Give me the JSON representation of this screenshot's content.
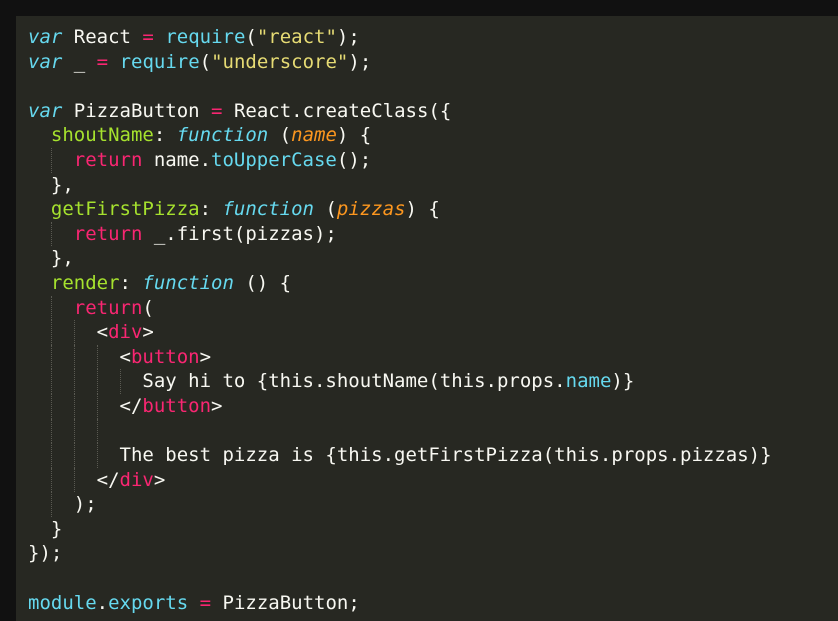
{
  "colors": {
    "background": "#272822",
    "frame": "#111111",
    "plain": "#F8F8F2",
    "storage": "#66D9EF",
    "keyword": "#F92672",
    "string": "#E6DB74",
    "function_name": "#A6E22E",
    "parameter": "#FD971F",
    "support": "#66D9EF"
  },
  "code": {
    "lines": [
      {
        "indent": 0,
        "tokens": [
          {
            "t": "var",
            "c": "storage",
            "i": true
          },
          {
            "t": " React ",
            "c": "plain"
          },
          {
            "t": "=",
            "c": "keyword"
          },
          {
            "t": " ",
            "c": "plain"
          },
          {
            "t": "require",
            "c": "support"
          },
          {
            "t": "(",
            "c": "plain"
          },
          {
            "t": "\"react\"",
            "c": "string"
          },
          {
            "t": ");",
            "c": "plain"
          }
        ]
      },
      {
        "indent": 0,
        "tokens": [
          {
            "t": "var",
            "c": "storage",
            "i": true
          },
          {
            "t": " _ ",
            "c": "plain"
          },
          {
            "t": "=",
            "c": "keyword"
          },
          {
            "t": " ",
            "c": "plain"
          },
          {
            "t": "require",
            "c": "support"
          },
          {
            "t": "(",
            "c": "plain"
          },
          {
            "t": "\"underscore\"",
            "c": "string"
          },
          {
            "t": ");",
            "c": "plain"
          }
        ]
      },
      {
        "indent": 0,
        "tokens": []
      },
      {
        "indent": 0,
        "tokens": [
          {
            "t": "var",
            "c": "storage",
            "i": true
          },
          {
            "t": " PizzaButton ",
            "c": "plain"
          },
          {
            "t": "=",
            "c": "keyword"
          },
          {
            "t": " React.createClass({",
            "c": "plain"
          }
        ]
      },
      {
        "indent": 1,
        "tokens": [
          {
            "t": "shoutName",
            "c": "function_name"
          },
          {
            "t": ": ",
            "c": "plain"
          },
          {
            "t": "function",
            "c": "storage",
            "i": true
          },
          {
            "t": " (",
            "c": "plain"
          },
          {
            "t": "name",
            "c": "parameter",
            "i": true
          },
          {
            "t": ") {",
            "c": "plain"
          }
        ]
      },
      {
        "indent": 2,
        "tokens": [
          {
            "t": "return",
            "c": "keyword"
          },
          {
            "t": " name.",
            "c": "plain"
          },
          {
            "t": "toUpperCase",
            "c": "support"
          },
          {
            "t": "();",
            "c": "plain"
          }
        ]
      },
      {
        "indent": 1,
        "tokens": [
          {
            "t": "},",
            "c": "plain"
          }
        ]
      },
      {
        "indent": 1,
        "tokens": [
          {
            "t": "getFirstPizza",
            "c": "function_name"
          },
          {
            "t": ": ",
            "c": "plain"
          },
          {
            "t": "function",
            "c": "storage",
            "i": true
          },
          {
            "t": " (",
            "c": "plain"
          },
          {
            "t": "pizzas",
            "c": "parameter",
            "i": true
          },
          {
            "t": ") {",
            "c": "plain"
          }
        ]
      },
      {
        "indent": 2,
        "tokens": [
          {
            "t": "return",
            "c": "keyword"
          },
          {
            "t": " _.first(pizzas);",
            "c": "plain"
          }
        ]
      },
      {
        "indent": 1,
        "tokens": [
          {
            "t": "},",
            "c": "plain"
          }
        ]
      },
      {
        "indent": 1,
        "tokens": [
          {
            "t": "render",
            "c": "function_name"
          },
          {
            "t": ": ",
            "c": "plain"
          },
          {
            "t": "function",
            "c": "storage",
            "i": true
          },
          {
            "t": " () {",
            "c": "plain"
          }
        ]
      },
      {
        "indent": 2,
        "tokens": [
          {
            "t": "return",
            "c": "keyword"
          },
          {
            "t": "(",
            "c": "plain"
          }
        ]
      },
      {
        "indent": 3,
        "tokens": [
          {
            "t": "<",
            "c": "plain"
          },
          {
            "t": "div",
            "c": "keyword"
          },
          {
            "t": ">",
            "c": "plain"
          }
        ]
      },
      {
        "indent": 4,
        "tokens": [
          {
            "t": "<",
            "c": "plain"
          },
          {
            "t": "button",
            "c": "keyword"
          },
          {
            "t": ">",
            "c": "plain"
          }
        ]
      },
      {
        "indent": 5,
        "tokens": [
          {
            "t": "Say hi to {this.shoutName(this.props.",
            "c": "plain"
          },
          {
            "t": "name",
            "c": "support"
          },
          {
            "t": ")}",
            "c": "plain"
          }
        ]
      },
      {
        "indent": 4,
        "tokens": [
          {
            "t": "</",
            "c": "plain"
          },
          {
            "t": "button",
            "c": "keyword"
          },
          {
            "t": ">",
            "c": "plain"
          }
        ]
      },
      {
        "indent": 4,
        "tokens": []
      },
      {
        "indent": 4,
        "tokens": [
          {
            "t": "The best pizza is {this.getFirstPizza(this.props.pizzas)}",
            "c": "plain"
          }
        ]
      },
      {
        "indent": 3,
        "tokens": [
          {
            "t": "</",
            "c": "plain"
          },
          {
            "t": "div",
            "c": "keyword"
          },
          {
            "t": ">",
            "c": "plain"
          }
        ]
      },
      {
        "indent": 2,
        "tokens": [
          {
            "t": ");",
            "c": "plain"
          }
        ]
      },
      {
        "indent": 1,
        "tokens": [
          {
            "t": "}",
            "c": "plain"
          }
        ]
      },
      {
        "indent": 0,
        "tokens": [
          {
            "t": "});",
            "c": "plain"
          }
        ]
      },
      {
        "indent": 0,
        "tokens": []
      },
      {
        "indent": 0,
        "tokens": [
          {
            "t": "module",
            "c": "support"
          },
          {
            "t": ".",
            "c": "plain"
          },
          {
            "t": "exports",
            "c": "support"
          },
          {
            "t": " ",
            "c": "plain"
          },
          {
            "t": "=",
            "c": "keyword"
          },
          {
            "t": " PizzaButton;",
            "c": "plain"
          }
        ]
      }
    ]
  }
}
